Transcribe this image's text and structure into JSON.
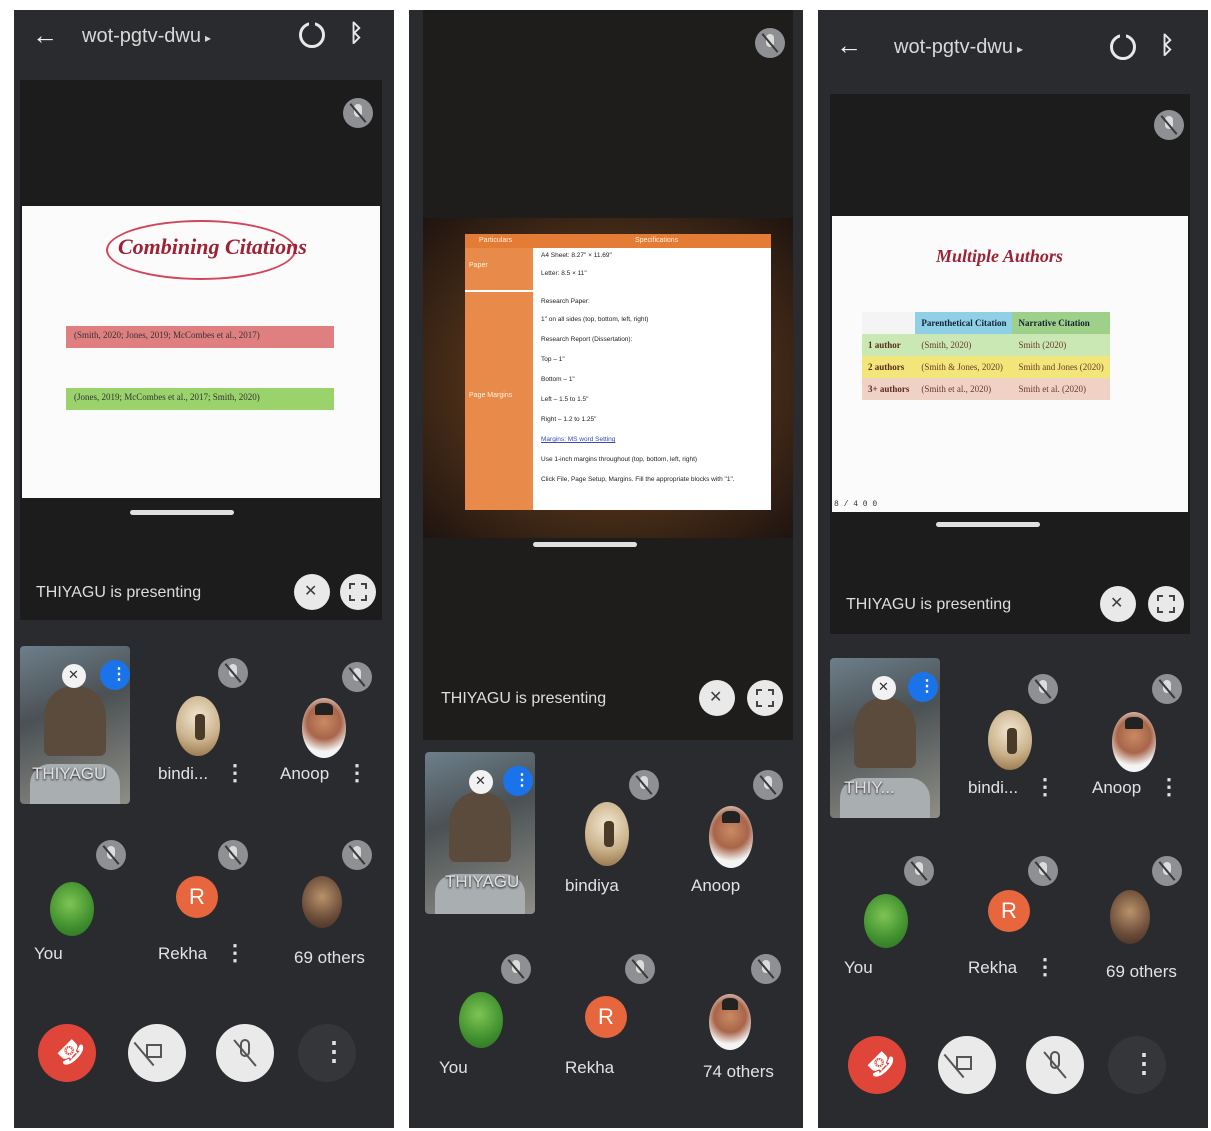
{
  "screens": [
    {
      "header": {
        "back_icon": "back-arrow-icon",
        "meeting_code": "wot-pgtv-dwu",
        "caret": "▸",
        "camera_icon": "switch-camera-icon",
        "bluetooth_icon": "bluetooth-icon"
      },
      "slide": {
        "title": "Combining Citations",
        "bar1": "(Smith, 2020; Jones, 2019; McCombes et al., 2017)",
        "bar2": "(Jones, 2019; McCombes et al., 2017; Smith, 2020)"
      },
      "presenting_text": "THIYAGU is presenting",
      "tiles": [
        {
          "name": "THIYAGU",
          "kind": "video"
        },
        {
          "name": "bindi...",
          "kind": "photo"
        },
        {
          "name": "Anoop",
          "kind": "photo"
        },
        {
          "name": "You",
          "kind": "photo"
        },
        {
          "name": "Rekha",
          "kind": "initial",
          "initial": "R"
        },
        {
          "name": "69 others",
          "kind": "group"
        }
      ],
      "controls": [
        "end-call",
        "camera-off",
        "mic-off",
        "more-options"
      ]
    },
    {
      "slide": {
        "header_left": "Particulars",
        "header_right": "Specifications",
        "row_paper": "Paper",
        "row_margins": "Page Margins",
        "lines": [
          "A4 Sheet: 8.27\" × 11.69\"",
          "Letter: 8.5 × 11\"",
          "Research Paper:",
          "1\" on all sides (top, bottom, left, right)",
          "Research Report (Dissertation):",
          "Top – 1\"",
          "Bottom – 1\"",
          "Left – 1.5 to 1.5\"",
          "Right – 1.2 to 1.25\"",
          "Margins: MS word Setting",
          "Use 1-inch margins throughout (top, bottom, left, right)",
          "Click File, Page Setup, Margins. Fill the appropriate blocks with \"1\"."
        ]
      },
      "presenting_text": "THIYAGU is presenting",
      "tiles": [
        {
          "name": "THIYAGU",
          "kind": "video"
        },
        {
          "name": "bindiya",
          "kind": "photo"
        },
        {
          "name": "Anoop",
          "kind": "photo"
        },
        {
          "name": "You",
          "kind": "photo"
        },
        {
          "name": "Rekha",
          "kind": "initial",
          "initial": "R"
        },
        {
          "name": "74 others",
          "kind": "group"
        }
      ]
    },
    {
      "header": {
        "meeting_code": "wot-pgtv-dwu",
        "caret": "▸"
      },
      "slide": {
        "title": "Multiple Authors",
        "col1": "Parenthetical Citation",
        "col2": "Narrative Citation",
        "rows": [
          {
            "label": "1 author",
            "paren": "(Smith, 2020)",
            "narr": "Smith (2020)"
          },
          {
            "label": "2 authors",
            "paren": "(Smith & Jones, 2020)",
            "narr": "Smith and Jones (2020)"
          },
          {
            "label": "3+ authors",
            "paren": "(Smith et al., 2020)",
            "narr": "Smith et al. (2020)"
          }
        ],
        "footer": "8 / 4 0 0"
      },
      "presenting_text": "THIYAGU is presenting",
      "tiles": [
        {
          "name": "THIY...",
          "kind": "video"
        },
        {
          "name": "bindi...",
          "kind": "photo"
        },
        {
          "name": "Anoop",
          "kind": "photo"
        },
        {
          "name": "You",
          "kind": "photo"
        },
        {
          "name": "Rekha",
          "kind": "initial",
          "initial": "R"
        },
        {
          "name": "69 others",
          "kind": "group"
        }
      ]
    }
  ],
  "colors": {
    "background": "#2a2b2e",
    "end_call": "#e0453a",
    "speaking": "#1a73e8",
    "rekha_avatar": "#e8663d"
  }
}
